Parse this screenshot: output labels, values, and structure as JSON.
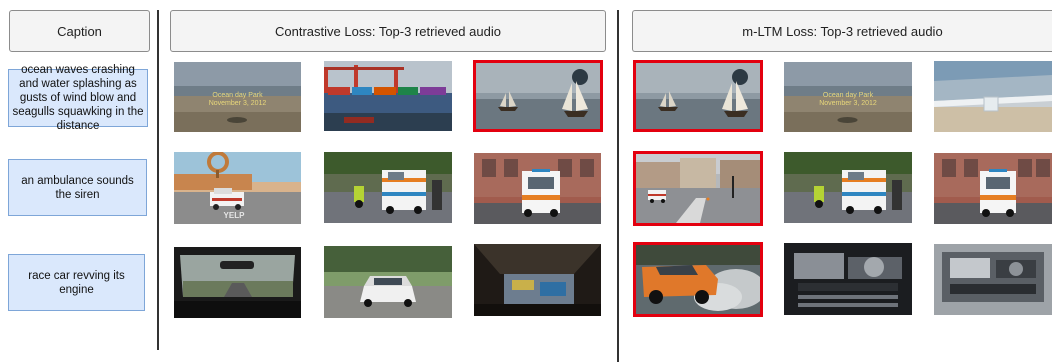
{
  "headers": {
    "caption": "Caption",
    "contrastive": "Contrastive Loss: Top-3 retrieved audio",
    "mltm": "m-LTM Loss: Top-3 retrieved audio"
  },
  "captions": [
    "ocean waves crashing and water splashing as gusts of wind blow and seagulls squawking in the distance",
    "an ambulance sounds the siren",
    "race car revving its engine"
  ],
  "overlays": {
    "beach_line1": "Ocean day Park",
    "beach_line2": "November 3, 2012",
    "yelp_sign": "YELP"
  },
  "highlight_color": "#e3000f",
  "thumbnails": {
    "contrastive": [
      [
        "beach-scene",
        "cargo-port-scene",
        "sailing-ships-scene"
      ],
      [
        "cartoon-ambulance-scene",
        "ambulance-street-scene",
        "ambulance-parked-scene"
      ],
      [
        "car-interior-scene",
        "white-car-scene",
        "car-engine-bay-scene"
      ]
    ],
    "mltm": [
      [
        "sailing-ships-scene",
        "beach-scene",
        "beach-shore-scene"
      ],
      [
        "city-square-ambulance-scene",
        "ambulance-street-scene",
        "ambulance-parked-scene"
      ],
      [
        "orange-car-burnout-scene",
        "engine-closeup-scene",
        "engine-bay-scene"
      ]
    ]
  }
}
